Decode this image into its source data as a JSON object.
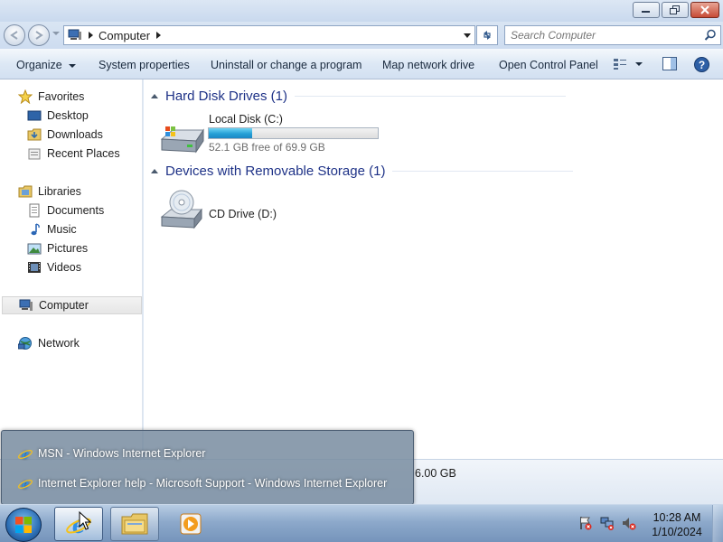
{
  "window": {
    "controls": {
      "minimize_icon": "minimize-icon",
      "restore_icon": "restore-icon",
      "close_icon": "close-icon"
    }
  },
  "address": {
    "crumb": "Computer",
    "search_placeholder": "Search Computer"
  },
  "toolbar": {
    "organize": "Organize",
    "system_properties": "System properties",
    "uninstall": "Uninstall or change a program",
    "map_drive": "Map network drive",
    "control_panel": "Open Control Panel"
  },
  "sidebar": {
    "favorites": "Favorites",
    "desktop": "Desktop",
    "downloads": "Downloads",
    "recent": "Recent Places",
    "libraries": "Libraries",
    "documents": "Documents",
    "music": "Music",
    "pictures": "Pictures",
    "videos": "Videos",
    "computer": "Computer",
    "network": "Network"
  },
  "content": {
    "hdd_group": "Hard Disk Drives (1)",
    "removable_group": "Devices with Removable Storage (1)",
    "local_disk": {
      "name": "Local Disk (C:)",
      "free_text": "52.1 GB free of 69.9 GB",
      "used_fraction": 0.255
    },
    "cd_drive": {
      "name": "CD Drive (D:)"
    }
  },
  "details": {
    "partial_text": "6.00 GB"
  },
  "popup": {
    "items": [
      {
        "label": "MSN - Windows Internet Explorer"
      },
      {
        "label": "Internet Explorer help - Microsoft Support - Windows Internet Explorer"
      }
    ]
  },
  "taskbar": {
    "time": "10:28 AM",
    "date": "1/10/2024"
  },
  "colors": {
    "accent": "#1e3287",
    "bar_fill": "#25a0d6",
    "taskbar": "#8da9cb"
  }
}
